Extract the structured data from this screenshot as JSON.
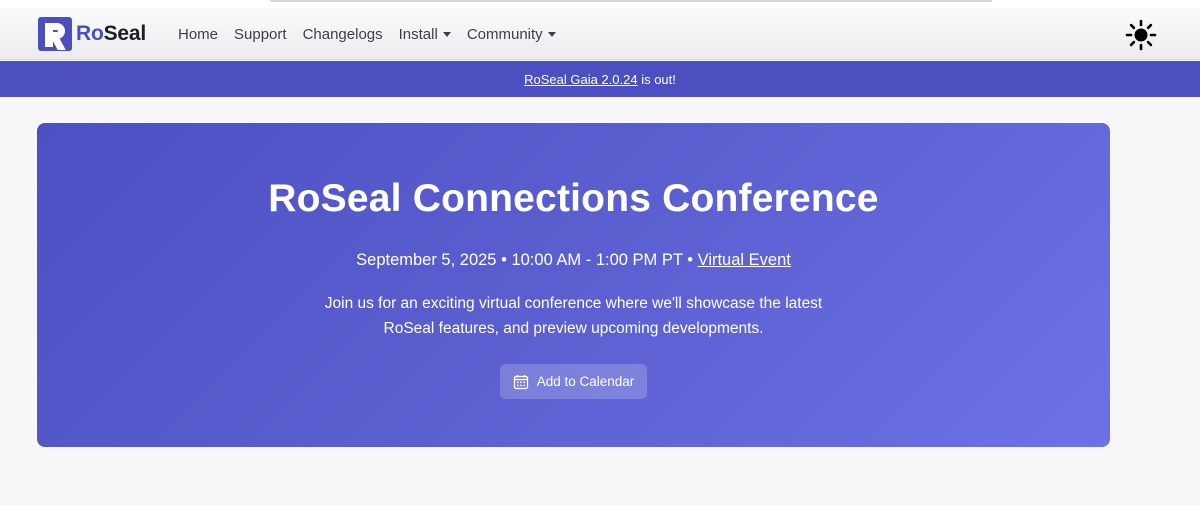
{
  "brand": {
    "name_prefix": "Ro",
    "name_suffix": "Seal"
  },
  "nav": {
    "items": [
      {
        "label": "Home"
      },
      {
        "label": "Support"
      },
      {
        "label": "Changelogs"
      },
      {
        "label": "Install"
      },
      {
        "label": "Community"
      }
    ]
  },
  "theme_toggle": {
    "icon": "sun-icon"
  },
  "announcement": {
    "link_text": "RoSeal Gaia 2.0.24",
    "suffix": " is out!"
  },
  "hero": {
    "title": "RoSeal Connections Conference",
    "date": "September 5, 2025",
    "separator": " • ",
    "time": "10:00 AM - 1:00 PM PT",
    "location_link": "Virtual Event",
    "description_line1": "Join us for an exciting virtual conference where we'll showcase the latest",
    "description_line2": "RoSeal features, and preview upcoming developments.",
    "calendar_button_label": "Add to Calendar",
    "calendar_icon": "calendar-icon"
  },
  "colors": {
    "accent": "#4b4fbf",
    "hero_gradient_start": "#4c50c3",
    "hero_gradient_end": "#6d71e6",
    "page_background": "#f7f7f8"
  }
}
